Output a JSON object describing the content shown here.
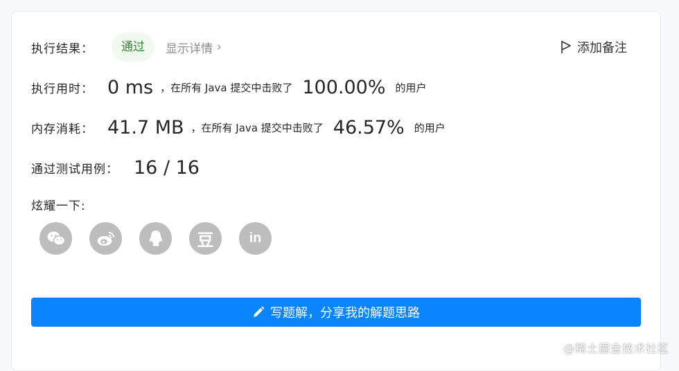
{
  "result": {
    "label": "执行结果：",
    "status": "通过",
    "details_link": "显示详情",
    "add_note": "添加备注"
  },
  "runtime": {
    "label": "执行用时：",
    "value": "0 ms",
    "middle": "，在所有 Java 提交中击败了",
    "percent": "100.00%",
    "suffix": "的用户"
  },
  "memory": {
    "label": "内存消耗：",
    "value": "41.7 MB",
    "middle": "，在所有 Java 提交中击败了",
    "percent": "46.57%",
    "suffix": "的用户"
  },
  "testcases": {
    "label": "通过测试用例：",
    "value": "16 / 16"
  },
  "share": {
    "label": "炫耀一下:",
    "icons": [
      "wechat-icon",
      "weibo-icon",
      "qq-icon",
      "douban-icon",
      "linkedin-icon"
    ],
    "douban_glyph": "豆",
    "linkedin_glyph": "in"
  },
  "cta": {
    "label": "写题解，分享我的解题思路"
  },
  "watermark": "@稀土掘金技术社区",
  "colors": {
    "accent": "#0a84ff",
    "success": "#2e8b2e",
    "icon_bg": "#bdbdbd"
  }
}
